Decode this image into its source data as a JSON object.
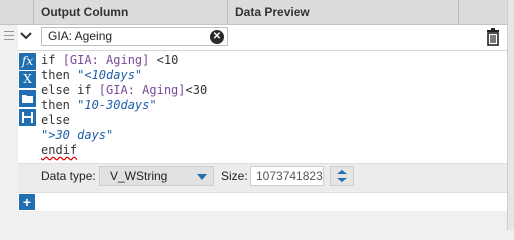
{
  "header": {
    "col_output": "Output Column",
    "col_preview": "Data Preview"
  },
  "row": {
    "field_name": "GIA: Ageing",
    "clear_symbol": "✕"
  },
  "expression": {
    "lines": [
      {
        "parts": [
          {
            "t": "if ",
            "c": "kw"
          },
          {
            "t": "[GIA: Aging]",
            "c": "fld"
          },
          {
            "t": " <10",
            "c": "kw"
          }
        ]
      },
      {
        "parts": [
          {
            "t": "then ",
            "c": "kw"
          },
          {
            "t": "\"<10days\"",
            "c": "str"
          }
        ]
      },
      {
        "parts": [
          {
            "t": "else if ",
            "c": "kw"
          },
          {
            "t": "[GIA: Aging]",
            "c": "fld"
          },
          {
            "t": "<30",
            "c": "kw"
          }
        ]
      },
      {
        "parts": [
          {
            "t": "then ",
            "c": "kw"
          },
          {
            "t": "\"10-30days\"",
            "c": "str"
          }
        ]
      },
      {
        "parts": [
          {
            "t": "else",
            "c": "kw"
          }
        ]
      },
      {
        "parts": [
          {
            "t": "\">30 days\"",
            "c": "str"
          }
        ]
      },
      {
        "parts": [
          {
            "t": "endif",
            "c": "kw err"
          }
        ]
      }
    ]
  },
  "side_buttons": {
    "fx": "fx",
    "x": "X"
  },
  "type_row": {
    "data_type_label": "Data type:",
    "data_type_value": "V_WString",
    "size_label": "Size:",
    "size_value": "1073741823"
  },
  "add_button": "+",
  "colors": {
    "accent": "#1f6fb2",
    "field": "#7a4a9a",
    "string": "#1e5fa8"
  }
}
